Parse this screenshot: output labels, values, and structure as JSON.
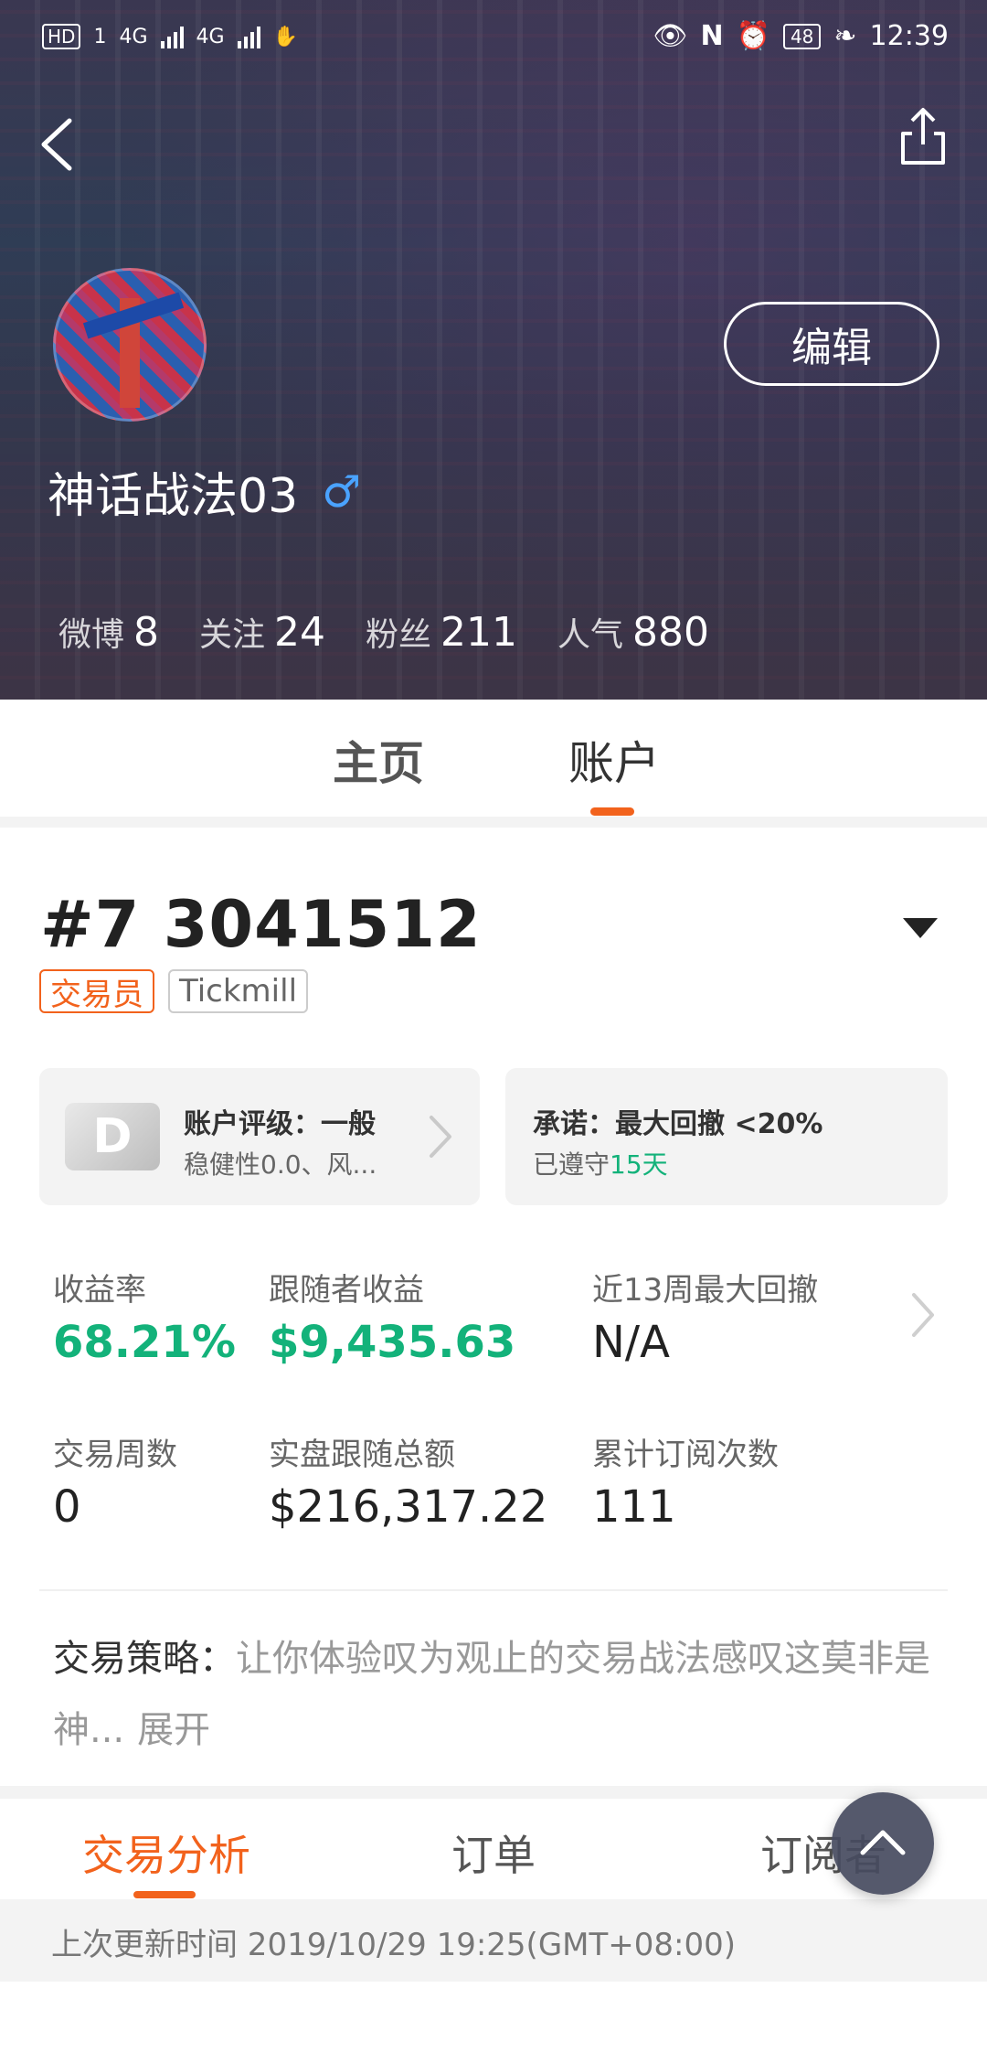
{
  "status_bar": {
    "left_badges": [
      "HD",
      "1",
      "4G",
      "4G"
    ],
    "right": {
      "battery": "48",
      "time": "12:39"
    }
  },
  "header": {
    "edit_label": "编辑",
    "username": "神话战法03",
    "gender_symbol": "♂",
    "stats": [
      {
        "label": "微博",
        "value": "8"
      },
      {
        "label": "关注",
        "value": "24"
      },
      {
        "label": "粉丝",
        "value": "211"
      },
      {
        "label": "人气",
        "value": "880"
      }
    ]
  },
  "tabs": [
    {
      "label": "主页",
      "active": false
    },
    {
      "label": "账户",
      "active": true
    }
  ],
  "account": {
    "title": "#7 3041512",
    "tags": [
      "交易员",
      "Tickmill"
    ],
    "rating_card": {
      "grade": "D",
      "title": "账户评级：一般",
      "subtitle": "稳健性0.0、风..."
    },
    "promise_card": {
      "title": "承诺：最大回撤 <20%",
      "kept_prefix": "已遵守",
      "kept_days": "15天"
    },
    "metrics": [
      {
        "label": "收益率",
        "value": "68.21%",
        "highlight": true
      },
      {
        "label": "跟随者收益",
        "value": "$9,435.63",
        "highlight": true
      },
      {
        "label": "近13周最大回撤",
        "value": "N/A",
        "highlight": false
      },
      {
        "label": "交易周数",
        "value": "0",
        "highlight": false
      },
      {
        "label": "实盘跟随总额",
        "value": "$216,317.22",
        "highlight": false
      },
      {
        "label": "累计订阅次数",
        "value": "111",
        "highlight": false
      }
    ],
    "strategy": {
      "label": "交易策略：",
      "text": "让你体验叹为观止的交易战法感叹这莫非是神...",
      "expand": "展开"
    }
  },
  "subtabs": [
    {
      "label": "交易分析",
      "active": true
    },
    {
      "label": "订单",
      "active": false
    },
    {
      "label": "订阅者",
      "active": false
    }
  ],
  "last_updated": "上次更新时间 2019/10/29 19:25(GMT+08:00)",
  "colors": {
    "accent": "#f2621c",
    "positive": "#13b27a",
    "gender": "#4aa3ff"
  }
}
